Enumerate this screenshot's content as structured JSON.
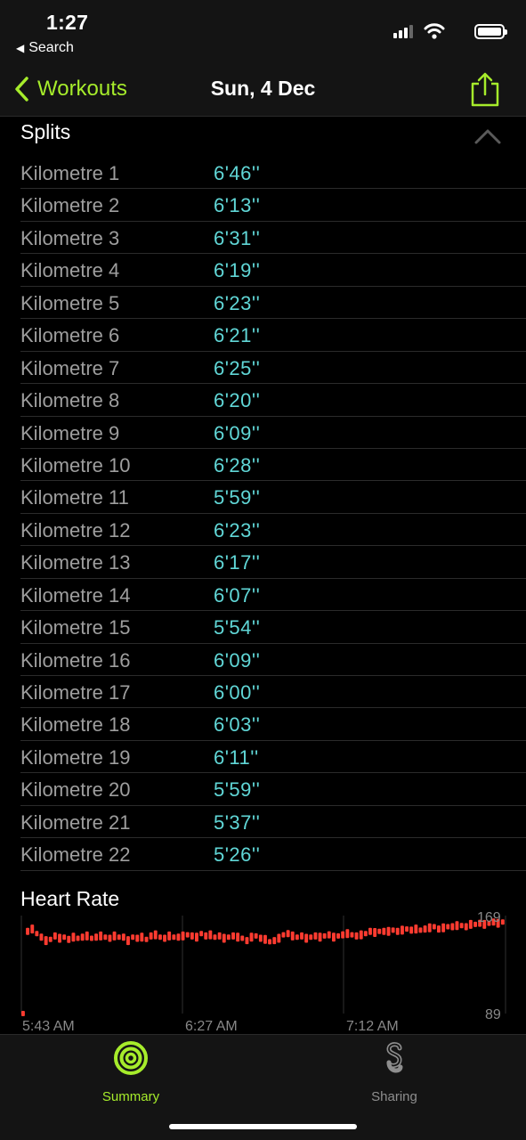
{
  "status_bar": {
    "time": "1:27",
    "back_app": "Search"
  },
  "nav": {
    "back_label": "Workouts",
    "title": "Sun, 4 Dec"
  },
  "splits": {
    "title": "Splits",
    "rows": [
      {
        "label": "Kilometre 1",
        "pace": "6'46''"
      },
      {
        "label": "Kilometre 2",
        "pace": "6'13''"
      },
      {
        "label": "Kilometre 3",
        "pace": "6'31''"
      },
      {
        "label": "Kilometre 4",
        "pace": "6'19''"
      },
      {
        "label": "Kilometre 5",
        "pace": "6'23''"
      },
      {
        "label": "Kilometre 6",
        "pace": "6'21''"
      },
      {
        "label": "Kilometre 7",
        "pace": "6'25''"
      },
      {
        "label": "Kilometre 8",
        "pace": "6'20''"
      },
      {
        "label": "Kilometre 9",
        "pace": "6'09''"
      },
      {
        "label": "Kilometre 10",
        "pace": "6'28''"
      },
      {
        "label": "Kilometre 11",
        "pace": "5'59''"
      },
      {
        "label": "Kilometre 12",
        "pace": "6'23''"
      },
      {
        "label": "Kilometre 13",
        "pace": "6'17''"
      },
      {
        "label": "Kilometre 14",
        "pace": "6'07''"
      },
      {
        "label": "Kilometre 15",
        "pace": "5'54''"
      },
      {
        "label": "Kilometre 16",
        "pace": "6'09''"
      },
      {
        "label": "Kilometre 17",
        "pace": "6'00''"
      },
      {
        "label": "Kilometre 18",
        "pace": "6'03''"
      },
      {
        "label": "Kilometre 19",
        "pace": "6'11''"
      },
      {
        "label": "Kilometre 20",
        "pace": "5'59''"
      },
      {
        "label": "Kilometre 21",
        "pace": "5'37''"
      },
      {
        "label": "Kilometre 22",
        "pace": "5'26''"
      }
    ]
  },
  "heart_rate": {
    "title": "Heart Rate",
    "y_max_label": "169",
    "y_min_label": "89",
    "time_labels": [
      "5:43 AM",
      "6:27 AM",
      "7:12 AM"
    ]
  },
  "chart_data": {
    "type": "bar",
    "ylim": [
      89,
      169
    ],
    "series": [
      {
        "color": "#ff3b30",
        "values": [
          89,
          160,
          162,
          158,
          155,
          152,
          153,
          156,
          154,
          155,
          153,
          155,
          154,
          155,
          156,
          154,
          155,
          156,
          155,
          154,
          156,
          155,
          155,
          152,
          155,
          154,
          155,
          153,
          156,
          157,
          155,
          154,
          156,
          155,
          155,
          156,
          157,
          156,
          155,
          158,
          156,
          157,
          155,
          156,
          154,
          155,
          156,
          155,
          154,
          152,
          155,
          156,
          154,
          153,
          151,
          152,
          154,
          157,
          158,
          156,
          155,
          156,
          154,
          155,
          156,
          155,
          156,
          157,
          155,
          156,
          157,
          158,
          157,
          156,
          157,
          158,
          160,
          159,
          160,
          160,
          160,
          161,
          160,
          161,
          162,
          161,
          162,
          161,
          162,
          163,
          164,
          162,
          163,
          164,
          164,
          165,
          165,
          164,
          166,
          166,
          167,
          166,
          167,
          168,
          167,
          168
        ]
      }
    ]
  },
  "tabs": [
    {
      "label": "Summary",
      "icon": "activity-rings-icon",
      "active": true
    },
    {
      "label": "Sharing",
      "icon": "sharing-icon",
      "active": false
    }
  ],
  "colors": {
    "accent": "#a6ec2b",
    "pace": "#60d6d6",
    "heart_rate": "#ff3b30"
  }
}
